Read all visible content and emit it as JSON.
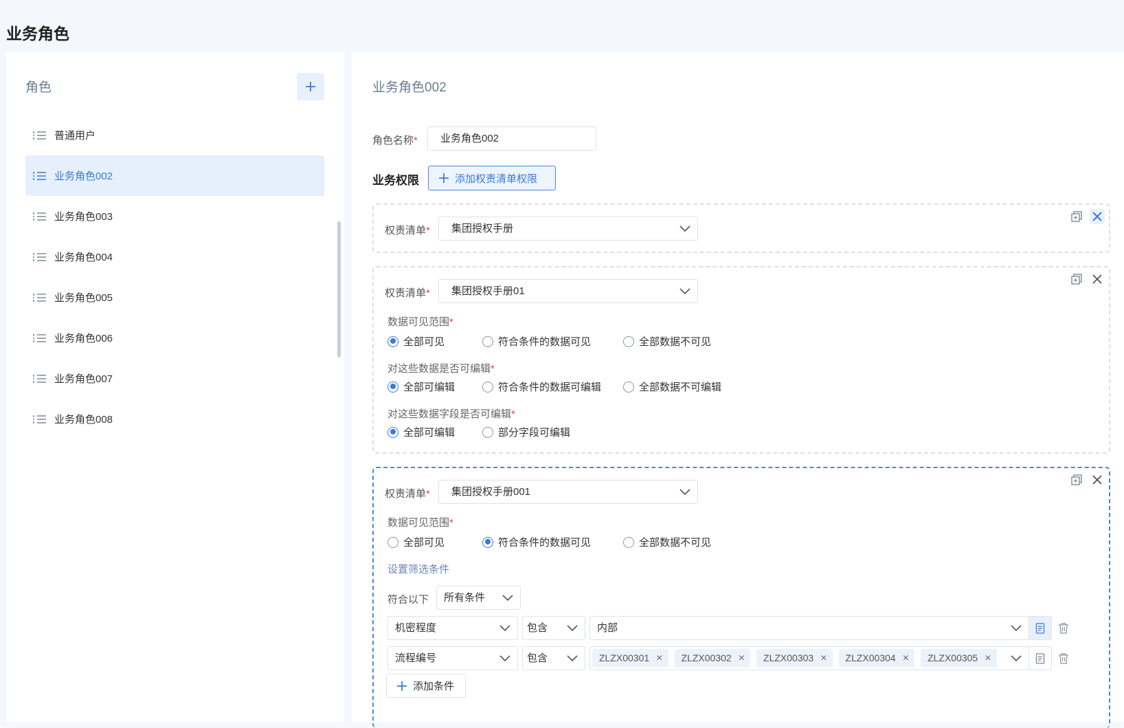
{
  "page": {
    "title": "业务角色"
  },
  "roles_panel": {
    "heading": "角色",
    "items": [
      {
        "label": "普通用户",
        "active": false
      },
      {
        "label": "业务角色002",
        "active": true
      },
      {
        "label": "业务角色003",
        "active": false
      },
      {
        "label": "业务角色004",
        "active": false
      },
      {
        "label": "业务角色005",
        "active": false
      },
      {
        "label": "业务角色006",
        "active": false
      },
      {
        "label": "业务角色007",
        "active": false
      },
      {
        "label": "业务角色008",
        "active": false
      }
    ]
  },
  "detail": {
    "title": "业务角色002",
    "role_name_label": "角色名称",
    "role_name_value": "业务角色002",
    "biz_perm_label": "业务权限",
    "add_list_button": "添加权责清单权限",
    "list_label": "权责清单",
    "cards": [
      {
        "list_value": "集团授权手册"
      },
      {
        "list_value": "集团授权手册01",
        "visibility_label": "数据可见范围",
        "visibility_options": [
          "全部可见",
          "符合条件的数据可见",
          "全部数据不可见"
        ],
        "visibility_selected": 0,
        "editable_label": "对这些数据是否可编辑",
        "editable_options": [
          "全部可编辑",
          "符合条件的数据可编辑",
          "全部数据不可编辑"
        ],
        "editable_selected": 0,
        "field_edit_label": "对这些数据字段是否可编辑",
        "field_edit_options": [
          "全部可编辑",
          "部分字段可编辑"
        ],
        "field_edit_selected": 0
      },
      {
        "list_value": "集团授权手册001",
        "visibility_label": "数据可见范围",
        "visibility_options": [
          "全部可见",
          "符合条件的数据可见",
          "全部数据不可见"
        ],
        "visibility_selected": 1,
        "filter_title": "设置筛选条件",
        "match_label": "符合以下",
        "match_value": "所有条件",
        "conditions": [
          {
            "field": "机密程度",
            "op": "包含",
            "value": "内部",
            "tags": []
          },
          {
            "field": "流程编号",
            "op": "包含",
            "value": "",
            "tags": [
              "ZLZX00301",
              "ZLZX00302",
              "ZLZX00303",
              "ZLZX00304",
              "ZLZX00305"
            ]
          }
        ],
        "add_condition_button": "添加条件"
      }
    ]
  },
  "colors": {
    "accent": "#3a7bd5",
    "required": "#e64545",
    "active_bg": "#e6effc"
  }
}
